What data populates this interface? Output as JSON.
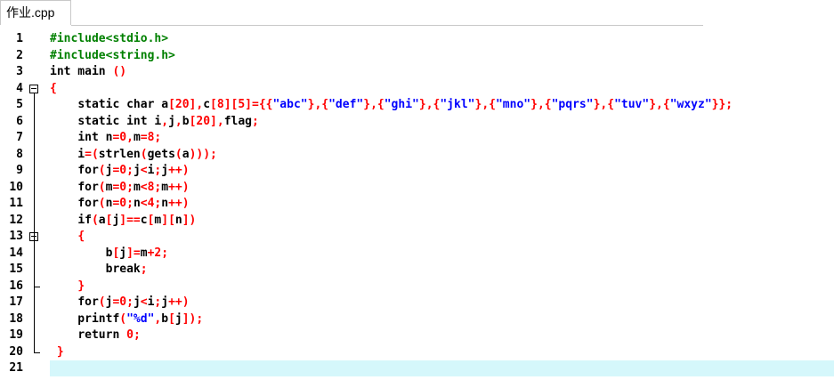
{
  "tab": {
    "title": "作业.cpp"
  },
  "lines": [
    {
      "n": "1",
      "toks": [
        [
          "pp",
          "#include<stdio.h>"
        ]
      ]
    },
    {
      "n": "2",
      "toks": [
        [
          "pp",
          "#include<string.h>"
        ]
      ]
    },
    {
      "n": "3",
      "toks": [
        [
          "kw",
          "int"
        ],
        [
          "id",
          " main "
        ],
        [
          "op",
          "()"
        ]
      ]
    },
    {
      "n": "4",
      "toks": [
        [
          "op",
          "{"
        ]
      ]
    },
    {
      "n": "5",
      "toks": [
        [
          "id",
          "    "
        ],
        [
          "kw",
          "static char"
        ],
        [
          "id",
          " a"
        ],
        [
          "op",
          "["
        ],
        [
          "num",
          "20"
        ],
        [
          "op",
          "],"
        ],
        [
          "id",
          "c"
        ],
        [
          "op",
          "["
        ],
        [
          "num",
          "8"
        ],
        [
          "op",
          "]["
        ],
        [
          "num",
          "5"
        ],
        [
          "op",
          "]={{"
        ],
        [
          "str",
          "\"abc\""
        ],
        [
          "op",
          "},{"
        ],
        [
          "str",
          "\"def\""
        ],
        [
          "op",
          "},{"
        ],
        [
          "str",
          "\"ghi\""
        ],
        [
          "op",
          "},{"
        ],
        [
          "str",
          "\"jkl\""
        ],
        [
          "op",
          "},{"
        ],
        [
          "str",
          "\"mno\""
        ],
        [
          "op",
          "},{"
        ],
        [
          "str",
          "\"pqrs\""
        ],
        [
          "op",
          "},{"
        ],
        [
          "str",
          "\"tuv\""
        ],
        [
          "op",
          "},{"
        ],
        [
          "str",
          "\"wxyz\""
        ],
        [
          "op",
          "}};"
        ]
      ]
    },
    {
      "n": "6",
      "toks": [
        [
          "id",
          "    "
        ],
        [
          "kw",
          "static int"
        ],
        [
          "id",
          " i"
        ],
        [
          "op",
          ","
        ],
        [
          "id",
          "j"
        ],
        [
          "op",
          ","
        ],
        [
          "id",
          "b"
        ],
        [
          "op",
          "["
        ],
        [
          "num",
          "20"
        ],
        [
          "op",
          "],"
        ],
        [
          "id",
          "flag"
        ],
        [
          "op",
          ";"
        ]
      ]
    },
    {
      "n": "7",
      "toks": [
        [
          "id",
          "    "
        ],
        [
          "kw",
          "int"
        ],
        [
          "id",
          " n"
        ],
        [
          "op",
          "="
        ],
        [
          "num",
          "0"
        ],
        [
          "op",
          ","
        ],
        [
          "id",
          "m"
        ],
        [
          "op",
          "="
        ],
        [
          "num",
          "8"
        ],
        [
          "op",
          ";"
        ]
      ]
    },
    {
      "n": "8",
      "toks": [
        [
          "id",
          "    i"
        ],
        [
          "op",
          "=("
        ],
        [
          "id",
          "strlen"
        ],
        [
          "op",
          "("
        ],
        [
          "id",
          "gets"
        ],
        [
          "op",
          "("
        ],
        [
          "id",
          "a"
        ],
        [
          "op",
          ")));"
        ]
      ]
    },
    {
      "n": "9",
      "toks": [
        [
          "id",
          "    "
        ],
        [
          "kw",
          "for"
        ],
        [
          "op",
          "("
        ],
        [
          "id",
          "j"
        ],
        [
          "op",
          "="
        ],
        [
          "num",
          "0"
        ],
        [
          "op",
          ";"
        ],
        [
          "id",
          "j"
        ],
        [
          "op",
          "<"
        ],
        [
          "id",
          "i"
        ],
        [
          "op",
          ";"
        ],
        [
          "id",
          "j"
        ],
        [
          "op",
          "++)"
        ]
      ]
    },
    {
      "n": "10",
      "toks": [
        [
          "id",
          "    "
        ],
        [
          "kw",
          "for"
        ],
        [
          "op",
          "("
        ],
        [
          "id",
          "m"
        ],
        [
          "op",
          "="
        ],
        [
          "num",
          "0"
        ],
        [
          "op",
          ";"
        ],
        [
          "id",
          "m"
        ],
        [
          "op",
          "<"
        ],
        [
          "num",
          "8"
        ],
        [
          "op",
          ";"
        ],
        [
          "id",
          "m"
        ],
        [
          "op",
          "++)"
        ]
      ]
    },
    {
      "n": "11",
      "toks": [
        [
          "id",
          "    "
        ],
        [
          "kw",
          "for"
        ],
        [
          "op",
          "("
        ],
        [
          "id",
          "n"
        ],
        [
          "op",
          "="
        ],
        [
          "num",
          "0"
        ],
        [
          "op",
          ";"
        ],
        [
          "id",
          "n"
        ],
        [
          "op",
          "<"
        ],
        [
          "num",
          "4"
        ],
        [
          "op",
          ";"
        ],
        [
          "id",
          "n"
        ],
        [
          "op",
          "++)"
        ]
      ]
    },
    {
      "n": "12",
      "toks": [
        [
          "id",
          "    "
        ],
        [
          "kw",
          "if"
        ],
        [
          "op",
          "("
        ],
        [
          "id",
          "a"
        ],
        [
          "op",
          "["
        ],
        [
          "id",
          "j"
        ],
        [
          "op",
          "]=="
        ],
        [
          "id",
          "c"
        ],
        [
          "op",
          "["
        ],
        [
          "id",
          "m"
        ],
        [
          "op",
          "]["
        ],
        [
          "id",
          "n"
        ],
        [
          "op",
          "])"
        ]
      ]
    },
    {
      "n": "13",
      "toks": [
        [
          "id",
          "    "
        ],
        [
          "op",
          "{"
        ]
      ]
    },
    {
      "n": "14",
      "toks": [
        [
          "id",
          "        b"
        ],
        [
          "op",
          "["
        ],
        [
          "id",
          "j"
        ],
        [
          "op",
          "]="
        ],
        [
          "id",
          "m"
        ],
        [
          "op",
          "+"
        ],
        [
          "num",
          "2"
        ],
        [
          "op",
          ";"
        ]
      ]
    },
    {
      "n": "15",
      "toks": [
        [
          "id",
          "        "
        ],
        [
          "kw",
          "break"
        ],
        [
          "op",
          ";"
        ]
      ]
    },
    {
      "n": "16",
      "toks": [
        [
          "id",
          "    "
        ],
        [
          "op",
          "}"
        ]
      ]
    },
    {
      "n": "17",
      "toks": [
        [
          "id",
          "    "
        ],
        [
          "kw",
          "for"
        ],
        [
          "op",
          "("
        ],
        [
          "id",
          "j"
        ],
        [
          "op",
          "="
        ],
        [
          "num",
          "0"
        ],
        [
          "op",
          ";"
        ],
        [
          "id",
          "j"
        ],
        [
          "op",
          "<"
        ],
        [
          "id",
          "i"
        ],
        [
          "op",
          ";"
        ],
        [
          "id",
          "j"
        ],
        [
          "op",
          "++)"
        ]
      ]
    },
    {
      "n": "18",
      "toks": [
        [
          "id",
          "    printf"
        ],
        [
          "op",
          "("
        ],
        [
          "str",
          "\"%d\""
        ],
        [
          "op",
          ","
        ],
        [
          "id",
          "b"
        ],
        [
          "op",
          "["
        ],
        [
          "id",
          "j"
        ],
        [
          "op",
          "]);"
        ]
      ]
    },
    {
      "n": "19",
      "toks": [
        [
          "id",
          "    "
        ],
        [
          "kw",
          "return"
        ],
        [
          "id",
          " "
        ],
        [
          "num",
          "0"
        ],
        [
          "op",
          ";"
        ]
      ]
    },
    {
      "n": "20",
      "toks": [
        [
          "id",
          " "
        ],
        [
          "op",
          "}"
        ]
      ]
    },
    {
      "n": "21",
      "toks": []
    }
  ],
  "current_line": "21"
}
